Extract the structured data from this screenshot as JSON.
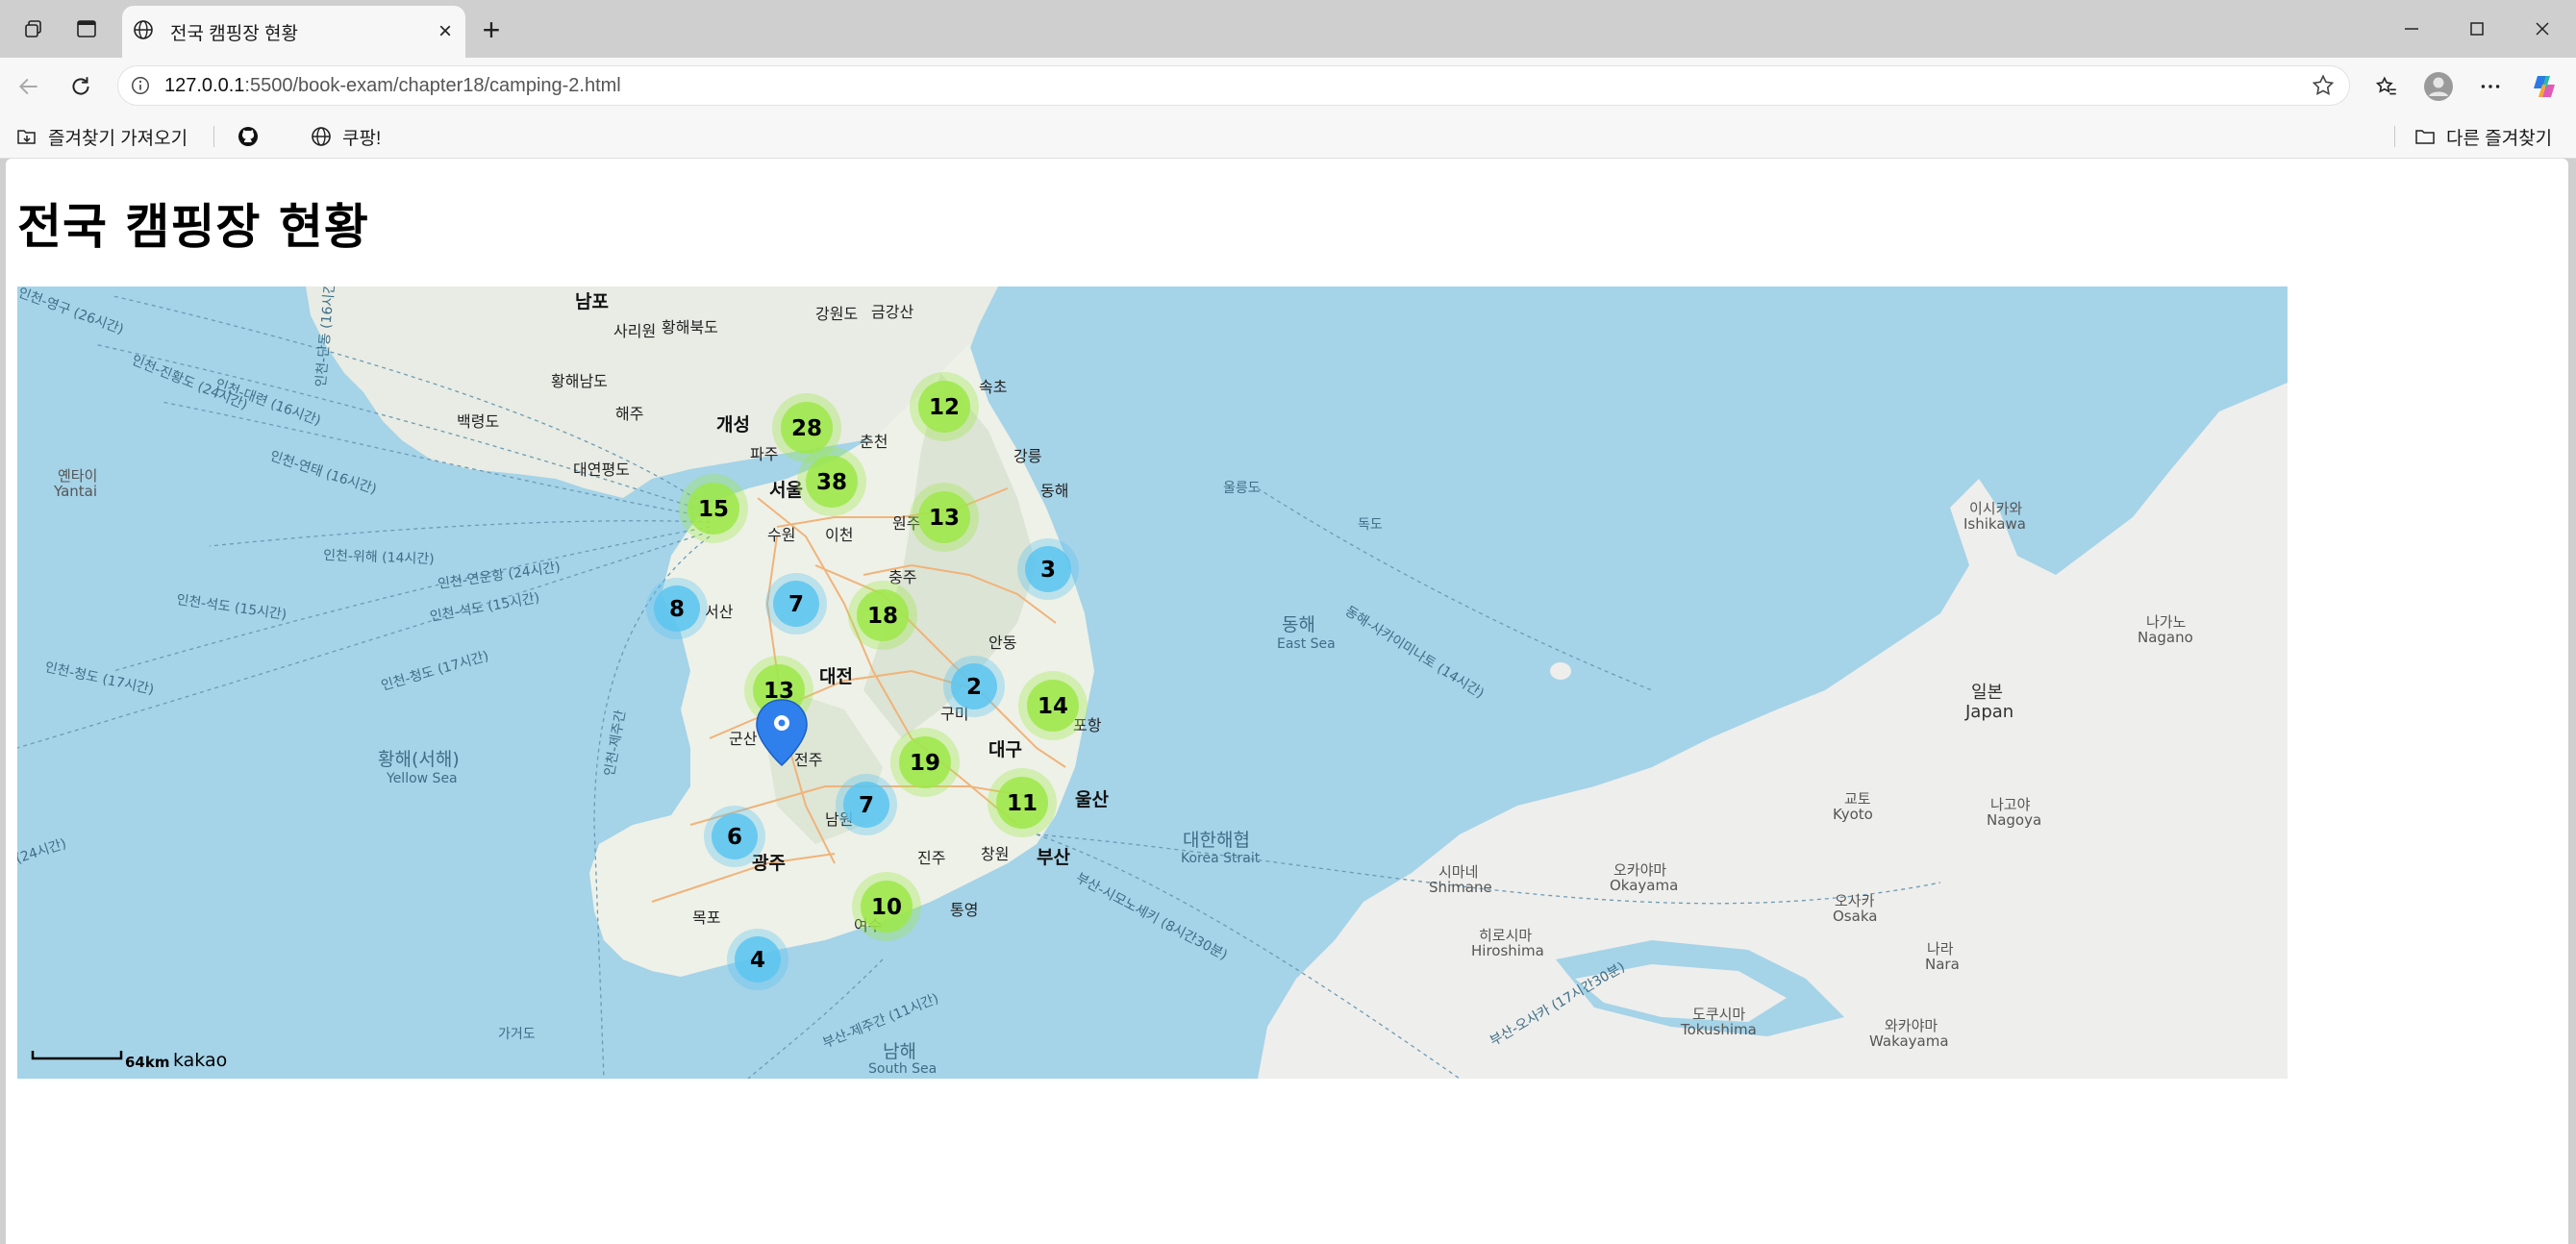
{
  "browser": {
    "tab_title": "전국 캠핑장 현황",
    "url_host": "127.0.0.1",
    "url_rest": ":5500/book-exam/chapter18/camping-2.html",
    "bookmarks": {
      "import_label": "즐겨찾기 가져오기",
      "coupang_label": "쿠팡!",
      "other_label": "다른 즐겨찾기"
    }
  },
  "page": {
    "heading": "전국 캠핑장 현황"
  },
  "map": {
    "clusters": [
      {
        "count": "12",
        "tone": "green"
      },
      {
        "count": "28",
        "tone": "green"
      },
      {
        "count": "38",
        "tone": "green"
      },
      {
        "count": "15",
        "tone": "green"
      },
      {
        "count": "13",
        "tone": "green"
      },
      {
        "count": "3",
        "tone": "blue"
      },
      {
        "count": "8",
        "tone": "blue"
      },
      {
        "count": "7",
        "tone": "blue"
      },
      {
        "count": "18",
        "tone": "green"
      },
      {
        "count": "2",
        "tone": "blue"
      },
      {
        "count": "14",
        "tone": "green"
      },
      {
        "count": "13",
        "tone": "green"
      },
      {
        "count": "19",
        "tone": "green"
      },
      {
        "count": "7",
        "tone": "blue"
      },
      {
        "count": "11",
        "tone": "green"
      },
      {
        "count": "6",
        "tone": "blue"
      },
      {
        "count": "10",
        "tone": "green"
      },
      {
        "count": "4",
        "tone": "blue"
      }
    ],
    "labels": {
      "east_sea": "동해",
      "east_sea_en": "East Sea",
      "yellow_sea": "황해(서해)",
      "yellow_sea_en": "Yellow Sea",
      "korea_strait": "대한해협",
      "korea_strait_en": "Korea Strait",
      "south_sea": "남해",
      "south_sea_en": "South Sea",
      "japan": "일본",
      "japan_en": "Japan",
      "ulleungdo": "울릉도",
      "dokdo": "독도",
      "gageodo": "가거도",
      "yantai": "옌타이",
      "yantai_en": "Yantai",
      "ishikawa": "이시카와",
      "ishikawa_en": "Ishikawa",
      "nagano": "나가노",
      "nagano_en": "Nagano",
      "kyoto": "교토",
      "kyoto_en": "Kyoto",
      "nagoya": "나고야",
      "nagoya_en": "Nagoya",
      "osaka": "오사카",
      "osaka_en": "Osaka",
      "nara": "나라",
      "nara_en": "Nara",
      "wakayama": "와카야마",
      "wakayama_en": "Wakayama",
      "tokushima": "도쿠시마",
      "tokushima_en": "Tokushima",
      "okayama": "오카야마",
      "okayama_en": "Okayama",
      "hiroshima": "히로시마",
      "hiroshima_en": "Hiroshima",
      "shimane": "시마네",
      "shimane_en": "Shimane",
      "nampo": "남포",
      "sariwon": "사리원",
      "hwanghaebukdo": "황해북도",
      "gangwondo_n": "강원도",
      "geumgangsan": "금강산",
      "hwanghaenamdo": "황해남도",
      "haeju": "해주",
      "baengnyeongdo": "백령도",
      "kaesong": "개성",
      "paju": "파주",
      "chuncheon": "춘천",
      "sokcho": "속초",
      "gangneung": "강릉",
      "donghae": "동해",
      "daeyeonpyeongdo": "대연평도",
      "seoul": "서울",
      "suwon": "수원",
      "icheon": "이천",
      "wonju": "원주",
      "chungju": "충주",
      "seosan": "서산",
      "andong": "안동",
      "daejeon": "대전",
      "gumi": "구미",
      "pohang": "포항",
      "gunsan": "군산",
      "jeonju": "전주",
      "daegu": "대구",
      "ulsan": "울산",
      "namwon": "남원",
      "jinju": "진주",
      "changwon": "창원",
      "busan": "부산",
      "gwangju": "광주",
      "mokpo": "목포",
      "tongyeong": "통영",
      "yeosu": "여수",
      "route_1": "인천-대련 (16시간)",
      "route_2": "인천-진황도 (24시간)",
      "route_3": "인천-연태 (16시간)",
      "route_4": "인천-위해 (14시간)",
      "route_5": "인천-연운항 (24시간)",
      "route_6": "인천-석도 (15시간)",
      "route_7": "인천-청도 (17시간)",
      "route_8": "인천-석도 (15시간)",
      "route_9": "인천-청도 (17시간)",
      "route_10": "인천-제주간",
      "route_11": "인천-단동 (16시간)",
      "route_12": "인천-영구 (26시간)",
      "route_13": "동해-사카이미나토 (14시간)",
      "route_14": "부산-시모노세키 (8시간30분)",
      "route_15": "부산-오사카 (17시간30분)",
      "route_16": "부산-제주간 (11시간)",
      "route_17": "(24시간)"
    },
    "scale_label": "64km",
    "brand": "kakao"
  }
}
